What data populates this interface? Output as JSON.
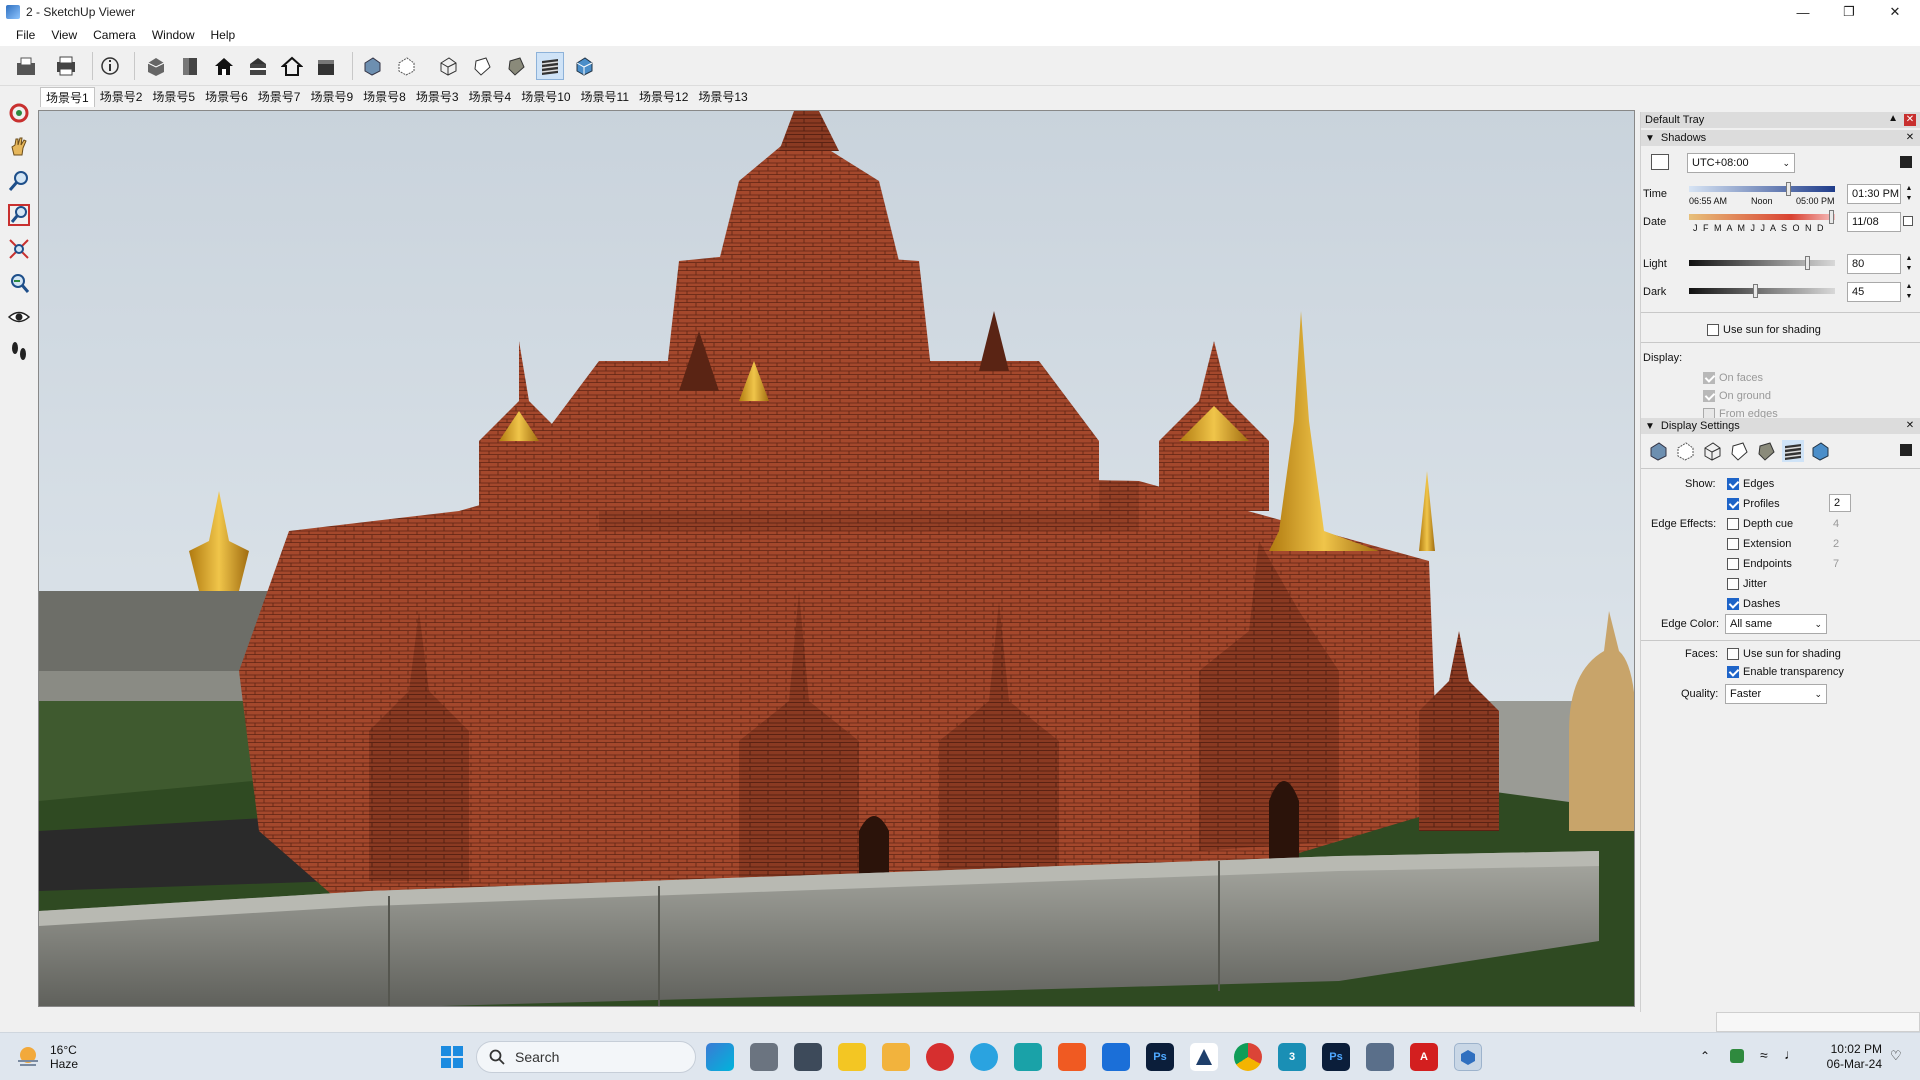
{
  "window": {
    "title": "2 - SketchUp Viewer",
    "minimize_icon": "minimize-icon",
    "maximize_icon": "restore-icon",
    "close_icon": "close-icon"
  },
  "menu": [
    "File",
    "View",
    "Camera",
    "Window",
    "Help"
  ],
  "toolbar": {
    "icons": [
      "open-file-icon",
      "print-icon",
      "model-info-icon",
      "iso-view-icon",
      "top-view-icon",
      "front-view-icon",
      "right-view-icon",
      "back-view-icon",
      "left-view-icon",
      "xray-icon",
      "back-edges-icon",
      "wireframe-icon",
      "hidden-line-icon",
      "shaded-icon",
      "shaded-textures-icon",
      "monochrome-icon"
    ]
  },
  "scenes": [
    "场景号1",
    "场景号2",
    "场景号5",
    "场景号6",
    "场景号7",
    "场景号9",
    "场景号8",
    "场景号3",
    "场景号4",
    "场景号10",
    "场景号11",
    "场景号12",
    "场景号13"
  ],
  "left_tools": [
    "orbit-icon",
    "pan-icon",
    "zoom-icon",
    "zoom-window-icon",
    "zoom-extents-icon",
    "zoom-previous-icon",
    "look-around-icon",
    "walk-icon"
  ],
  "tray": {
    "title": "Default Tray",
    "shadows": {
      "header": "Shadows",
      "timezone": "UTC+08:00",
      "time_label": "Time",
      "time_start": "06:55 AM",
      "time_noon": "Noon",
      "time_end": "05:00 PM",
      "time_value": "01:30 PM",
      "time_fraction": 0.68,
      "date_label": "Date",
      "months": "J F M A M J J A S O N D",
      "date_value": "11/08",
      "light_label": "Light",
      "light_value": "80",
      "dark_label": "Dark",
      "dark_value": "45",
      "use_sun": "Use sun for shading",
      "display_label": "Display:",
      "on_faces": "On faces",
      "on_ground": "On ground",
      "from_edges": "From edges"
    },
    "display_settings": {
      "header": "Display Settings",
      "show_label": "Show:",
      "edges": "Edges",
      "profiles": "Profiles",
      "profiles_value": "2",
      "edge_effects_label": "Edge Effects:",
      "depth_cue": "Depth cue",
      "depth_cue_value": "4",
      "extension": "Extension",
      "extension_value": "2",
      "endpoints": "Endpoints",
      "endpoints_value": "7",
      "jitter": "Jitter",
      "dashes": "Dashes",
      "edge_color_label": "Edge Color:",
      "edge_color_value": "All same",
      "faces_label": "Faces:",
      "use_sun": "Use sun for shading",
      "enable_transparency": "Enable transparency",
      "quality_label": "Quality:",
      "quality_value": "Faster"
    }
  },
  "taskbar": {
    "weather_temp": "16°C",
    "weather_desc": "Haze",
    "search_placeholder": "Search",
    "time": "10:02 PM",
    "date": "06-Mar-24",
    "apps": [
      "windows-start-icon",
      "file-explorer-icon",
      "calculator-icon",
      "sticky-notes-icon",
      "folder-icon",
      "opera-icon",
      "telegram-icon",
      "app-icon",
      "brave-icon",
      "feedback-icon",
      "photoshop-icon",
      "autodesk-icon",
      "chrome-icon",
      "app-icon-2",
      "photoshop-icon-2",
      "image-viewer-icon",
      "acrobat-icon",
      "sketchup-viewer-icon"
    ]
  }
}
